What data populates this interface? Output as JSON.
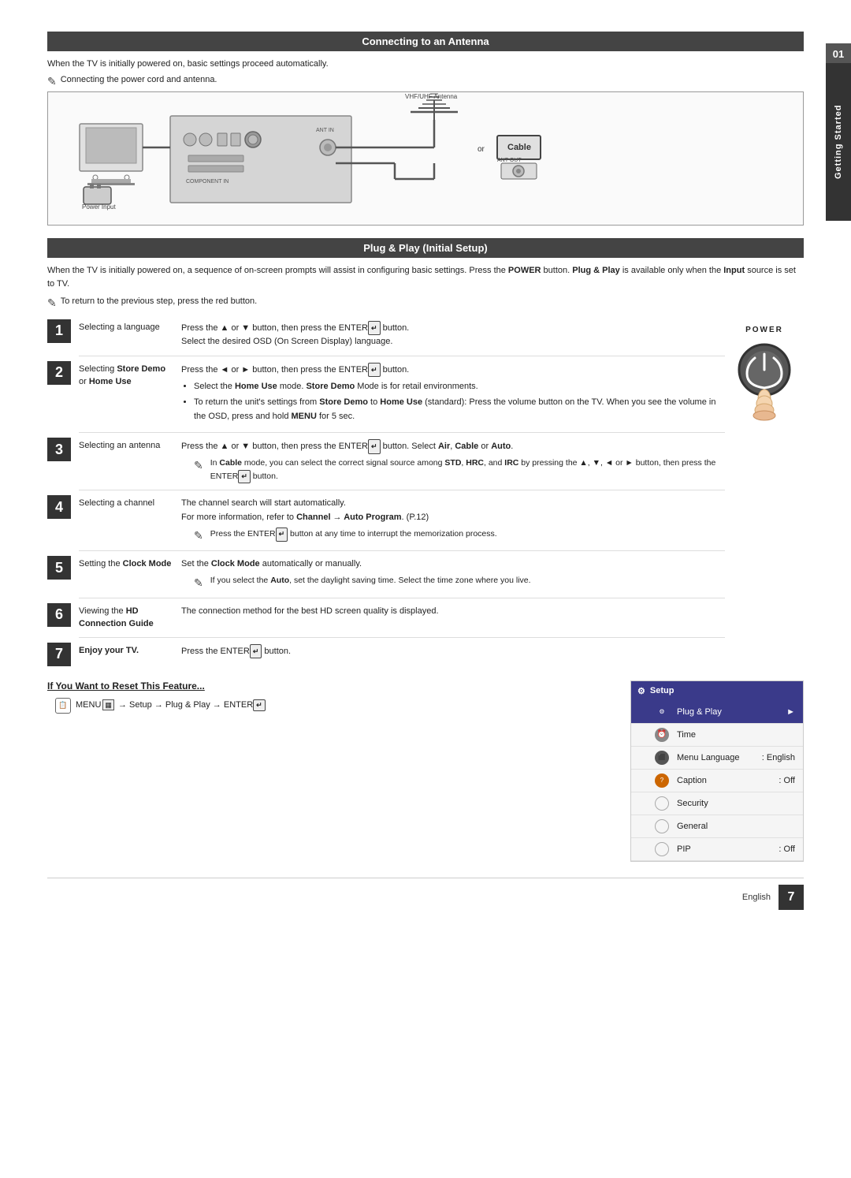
{
  "page": {
    "side_tab": "Getting Started",
    "side_tab_num": "01"
  },
  "section1": {
    "title": "Connecting to an Antenna",
    "intro": "When the TV is initially powered on, basic settings proceed automatically.",
    "note": "Connecting the power cord and antenna.",
    "diagram": {
      "vhf_label": "VHF/UHF Antenna",
      "or_label": "or",
      "cable_label": "Cable",
      "ant_out_label": "ANT OUT",
      "power_input_label": "Power Input"
    }
  },
  "section2": {
    "title": "Plug & Play (Initial Setup)",
    "intro": "When the TV is initially powered on, a sequence of on-screen prompts will assist in configuring basic settings. Press the POWER button. Plug & Play is available only when the Input source is set to TV.",
    "note": "To return to the previous step, press the red button.",
    "power_label": "POWER",
    "steps": [
      {
        "number": "1",
        "label": "Selecting a language",
        "desc": "Press the ▲ or ▼ button, then press the ENTER button.",
        "desc2": "Select the desired OSD (On Screen Display) language."
      },
      {
        "number": "2",
        "label": "Selecting Store Demo or Home Use",
        "desc": "Press the ◄ or ► button, then press the ENTER button.",
        "bullets": [
          "Select the Home Use mode. Store Demo Mode is for retail environments.",
          "To return the unit's settings from Store Demo to Home Use (standard): Press the volume button on the TV. When you see the volume in the OSD, press and hold MENU for 5 sec."
        ]
      },
      {
        "number": "3",
        "label": "Selecting an antenna",
        "desc": "Press the ▲ or ▼ button, then press the ENTER button. Select Air, Cable or Auto.",
        "note": "In Cable mode, you can select the correct signal source among STD, HRC, and IRC by pressing the ▲, ▼, ◄ or ► button, then press the ENTER button."
      },
      {
        "number": "4",
        "label": "Selecting a channel",
        "desc": "The channel search will start automatically.",
        "desc2": "For more information, refer to Channel → Auto Program. (P.12)",
        "note": "Press the ENTER button at any time to interrupt the memorization process."
      },
      {
        "number": "5",
        "label": "Setting the Clock Mode",
        "desc": "Set the Clock Mode automatically or manually.",
        "note": "If you select the Auto, set the daylight saving time. Select the time zone where you live."
      },
      {
        "number": "6",
        "label": "Viewing the HD Connection Guide",
        "desc": "The connection method for the best HD screen quality is displayed."
      },
      {
        "number": "7",
        "label": "Enjoy your TV.",
        "desc": "Press the ENTER button."
      }
    ]
  },
  "reset_section": {
    "title": "If You Want to Reset This Feature...",
    "cmd": "MENU  → Setup → Plug & Play → ENTER"
  },
  "setup_menu": {
    "header_icon": "⚙",
    "header_label": "Setup",
    "items": [
      {
        "icon": "⚙",
        "icon_type": "blue",
        "label": "Plug & Play",
        "value": "",
        "highlighted": true,
        "arrow": "►"
      },
      {
        "icon": "⏰",
        "icon_type": "gray",
        "label": "Time",
        "value": "",
        "highlighted": false
      },
      {
        "icon": "⬛",
        "icon_type": "gray",
        "label": "Menu Language",
        "value": ": English",
        "highlighted": false
      },
      {
        "icon": "?",
        "icon_type": "orange",
        "label": "Caption",
        "value": ": Off",
        "highlighted": false
      },
      {
        "icon": "",
        "icon_type": "none",
        "label": "Security",
        "value": "",
        "highlighted": false
      },
      {
        "icon": "",
        "icon_type": "none",
        "label": "General",
        "value": "",
        "highlighted": false
      },
      {
        "icon": "",
        "icon_type": "none",
        "label": "PIP",
        "value": ": Off",
        "highlighted": false
      }
    ]
  },
  "footer": {
    "lang": "English",
    "page": "7"
  }
}
